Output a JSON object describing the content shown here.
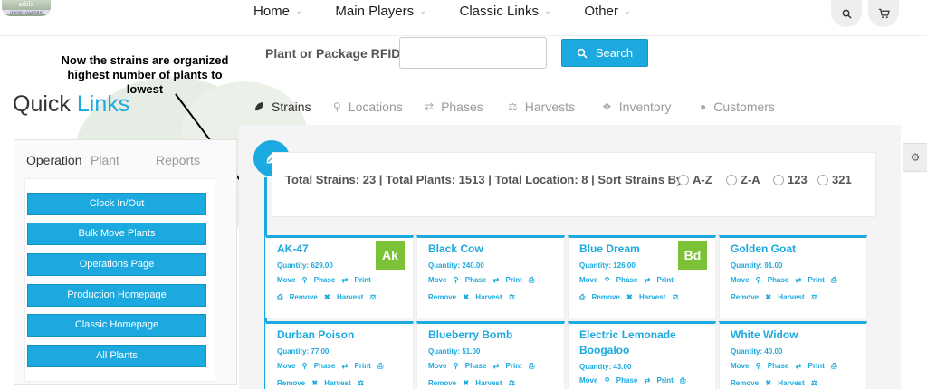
{
  "logo": {
    "text": "adila",
    "sub": "GROW+GARDEN"
  },
  "nav": {
    "items": [
      {
        "label": "Home"
      },
      {
        "label": "Main Players"
      },
      {
        "label": "Classic Links"
      },
      {
        "label": "Other"
      }
    ]
  },
  "annotation": {
    "text": "Now the strains are organized highest number of plants to lowest"
  },
  "rfid": {
    "label": "Plant or Package RFID:",
    "value": "",
    "placeholder": ""
  },
  "search": {
    "label": "Search",
    "icon": "search-icon"
  },
  "quick_links": {
    "title_plain": "Quick ",
    "title_accent": "Links",
    "accent_color": "#1ba9df",
    "tabs": [
      "Operation",
      "Plant",
      "Reports"
    ],
    "active_tab": "Operation",
    "buttons": [
      "Clock In/Out",
      "Bulk Move Plants",
      "Operations Page",
      "Production Homepage",
      "Classic Homepage",
      "All Plants"
    ]
  },
  "main_tabs": [
    {
      "label": "Strains",
      "icon": "leaf-icon",
      "active": true
    },
    {
      "label": "Locations",
      "icon": "map-pin-icon",
      "active": false
    },
    {
      "label": "Phases",
      "icon": "shuffle-icon",
      "active": false
    },
    {
      "label": "Harvests",
      "icon": "scale-icon",
      "active": false
    },
    {
      "label": "Inventory",
      "icon": "cubes-icon",
      "active": false
    },
    {
      "label": "Customers",
      "icon": "user-icon",
      "active": false
    }
  ],
  "totals": {
    "text": "Total Strains: 23 | Total Plants: 1513 | Total Location: 8 | Sort Strains By:",
    "sort_options": [
      "A-Z",
      "Z-A",
      "123",
      "321"
    ]
  },
  "card_actions": {
    "move": "Move",
    "phase": "Phase",
    "print": "Print",
    "remove": "Remove",
    "harvest": "Harvest"
  },
  "strains": [
    {
      "name": "AK-47",
      "quantity": "Quantity: 629.00",
      "badge": "Ak"
    },
    {
      "name": "Black Cow",
      "quantity": "Quantity: 240.00",
      "badge": ""
    },
    {
      "name": "Blue Dream",
      "quantity": "Quantity: 126.00",
      "badge": "Bd",
      "badge_sub": "Blue Dream"
    },
    {
      "name": "Golden Goat",
      "quantity": "Quantity: 91.00",
      "badge": ""
    },
    {
      "name": "Durban Poison",
      "quantity": "Quantity: 77.00",
      "badge": ""
    },
    {
      "name": "Blueberry Bomb",
      "quantity": "Quantity: 51.00",
      "badge": ""
    },
    {
      "name": "Electric Lemonade Boogaloo",
      "quantity": "Quantity: 43.00",
      "badge": ""
    },
    {
      "name": "White Widow",
      "quantity": "Quantity: 40.00",
      "badge": ""
    }
  ]
}
